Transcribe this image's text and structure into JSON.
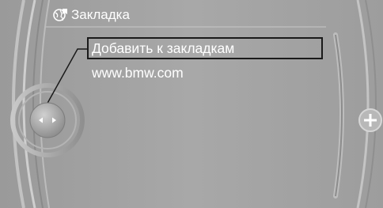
{
  "header": {
    "title": "Закладка",
    "icon": "bookmark-globe-icon"
  },
  "menu": {
    "items": [
      {
        "label": "Добавить к закладкам",
        "selected": true
      },
      {
        "label": "www.bmw.com",
        "selected": false
      }
    ]
  },
  "controller": {
    "left_icon": "arrow-left-icon",
    "right_icon": "arrow-right-icon"
  },
  "side_button": {
    "icon": "plus-icon"
  },
  "colors": {
    "background": "#a4a4a4",
    "text": "#ffffff",
    "selection_border": "#1a1a1a"
  }
}
